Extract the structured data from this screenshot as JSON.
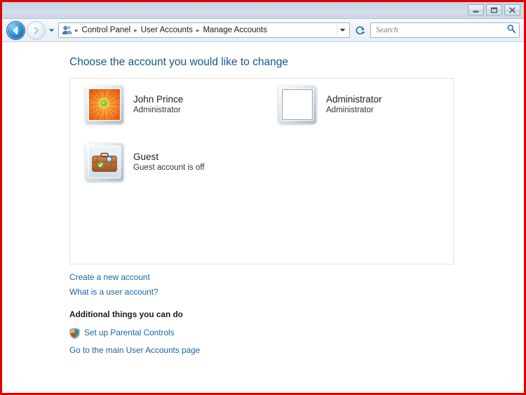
{
  "window": {
    "controls": [
      {
        "name": "minimize",
        "glyph": "minimize-icon"
      },
      {
        "name": "maximize",
        "glyph": "maximize-icon"
      },
      {
        "name": "close",
        "glyph": "close-icon"
      }
    ]
  },
  "navigation": {
    "back_label": "Back",
    "forward_label": "Forward",
    "recent_pages_label": "Recent pages",
    "breadcrumb_icon": "user-accounts-icon",
    "breadcrumbs": [
      {
        "label": "Control Panel"
      },
      {
        "label": "User Accounts"
      },
      {
        "label": "Manage Accounts"
      }
    ],
    "separator": "▸",
    "address_dropdown_label": "Previous locations",
    "refresh_label": "Refresh"
  },
  "search": {
    "placeholder": "Search",
    "value": "",
    "icon": "search-icon"
  },
  "main": {
    "title": "Choose the account you would like to change",
    "accounts": [
      {
        "name": "John Prince",
        "description": "Administrator",
        "avatar": "flower-avatar"
      },
      {
        "name": "Administrator",
        "description": "Administrator",
        "avatar": "blank-avatar"
      },
      {
        "name": "Guest",
        "description": "Guest account is off",
        "avatar": "suitcase-avatar"
      }
    ],
    "links": [
      {
        "label": "Create a new account"
      },
      {
        "label": "What is a user account?"
      }
    ],
    "additional_heading": "Additional things you can do",
    "additional_links": [
      {
        "label": "Set up Parental Controls",
        "icon": "uac-shield-icon"
      },
      {
        "label": "Go to the main User Accounts page",
        "icon": ""
      }
    ]
  },
  "colors": {
    "accent_link": "#1764a8",
    "title_text": "#17548a",
    "frame_red": "#e00000",
    "titlebar_blue": "#cdd9e8"
  }
}
